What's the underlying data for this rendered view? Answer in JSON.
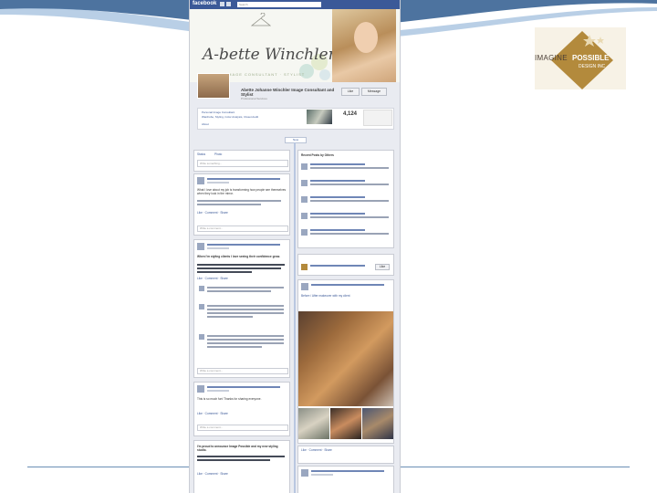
{
  "slide": {
    "logo": {
      "word_left": "IMAGINE",
      "word_right": "POSSIBLE",
      "word_small": "DESIGN INC"
    }
  },
  "facebook": {
    "brand": "facebook",
    "search_placeholder": "Search",
    "cover_script": "A-bette Winchler",
    "cover_tagline": "IMAGE CONSULTANT · STYLIST",
    "page_name": "Abette Johanne Winchler Image Consultant and Stylist",
    "page_category": "Professional Services",
    "like_button": "Like",
    "message_button": "Message",
    "about_line_1": "Personal Image Consultant",
    "about_line_2": "Wardrobe, Styling, Color Analysis, Closet Audit",
    "about_link": "About",
    "likes_count": "4,124",
    "likes_label": "Likes",
    "timeline_pill": "Now",
    "status_tab": "Status",
    "photo_tab": "Photo",
    "composer_placeholder": "Write something...",
    "post_author": "Abette Johanne Winchler Image Consultant and Stylist",
    "post1_text": "What I love about my job is transforming how people see themselves when they look in the mirror.",
    "post2_text": "When I'm styling clients I love seeing their confidence grow.",
    "post3_text": "This is so much fun! Thanks for sharing everyone.",
    "post4_text": "I'm proud to announce Image Possible and my new styling studio.",
    "comment_placeholder": "Write a comment...",
    "recent_title": "Recent Posts by Others",
    "photo_post_title": "Before / After makeover with my client",
    "like_comment": "Like · Comment · Share"
  }
}
